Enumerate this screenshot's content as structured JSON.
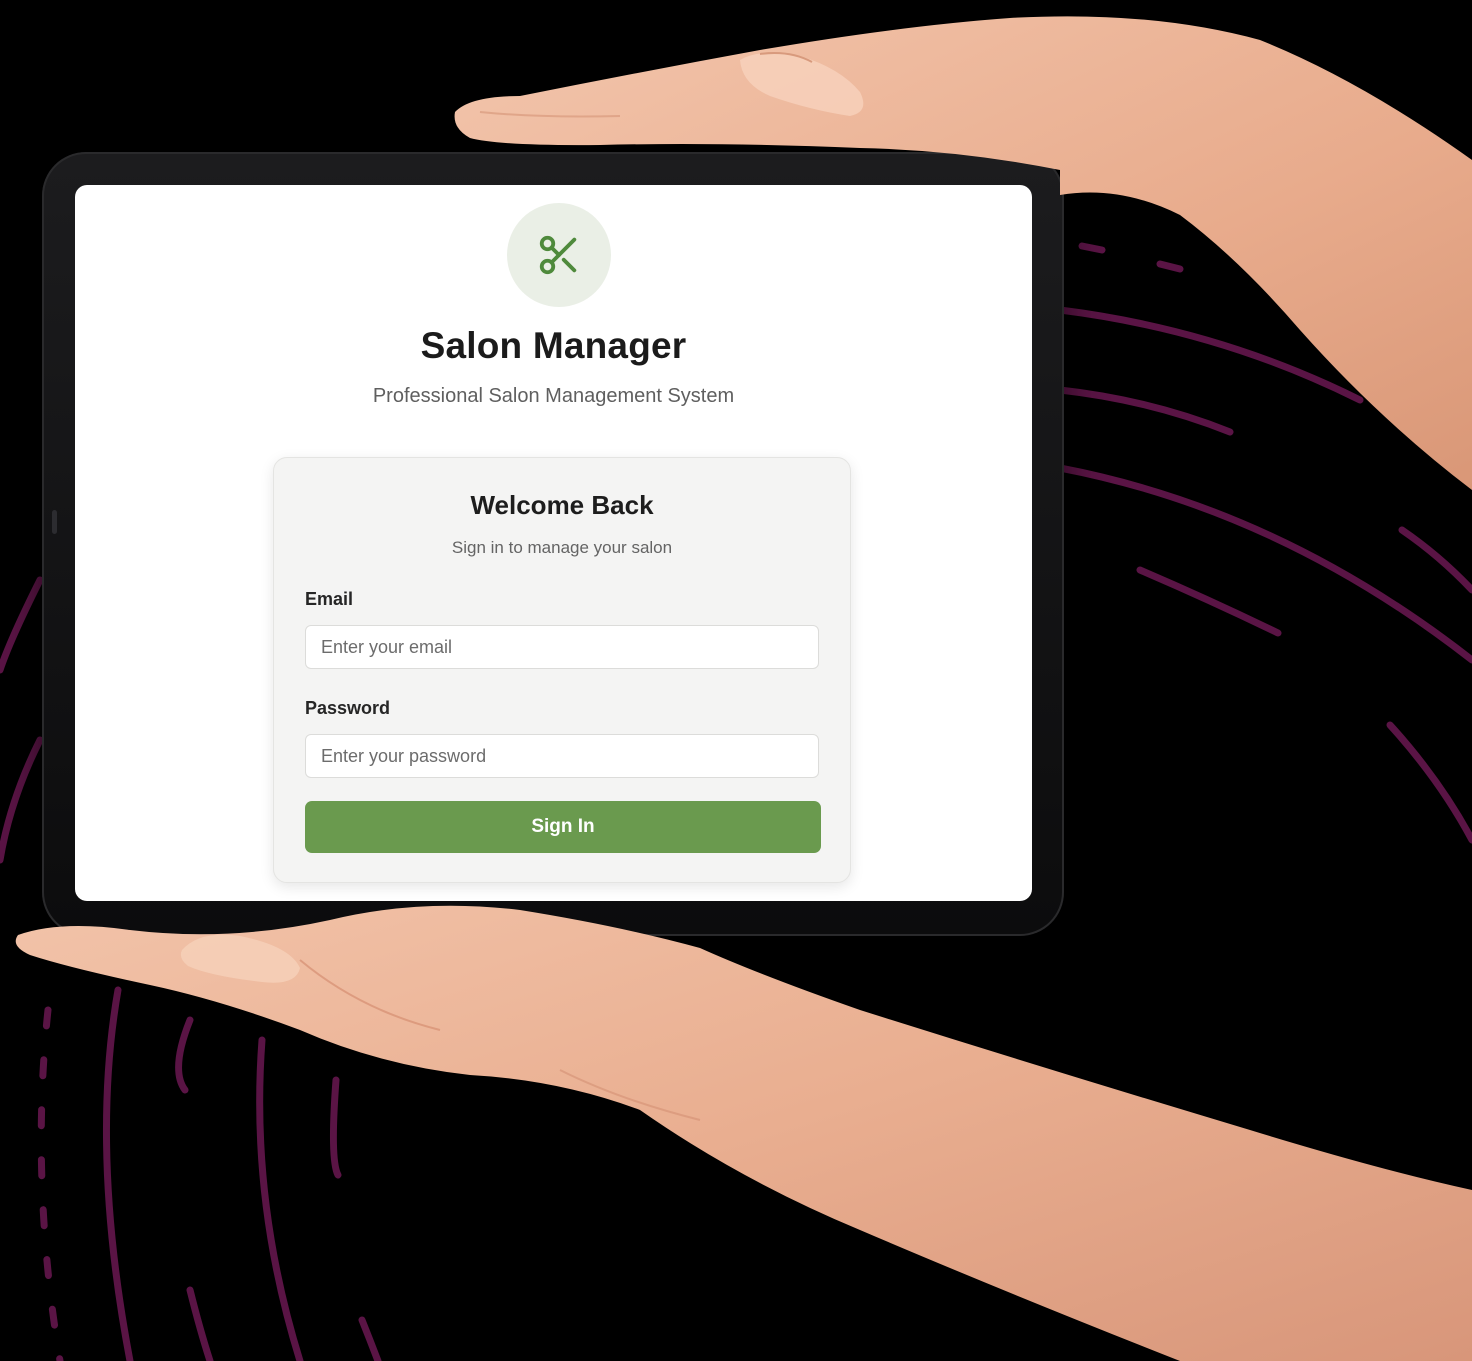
{
  "app": {
    "title": "Salon Manager",
    "subtitle": "Professional Salon Management System",
    "logo_icon": "scissors-icon"
  },
  "login_card": {
    "title": "Welcome Back",
    "subtitle": "Sign in to manage your salon",
    "email": {
      "label": "Email",
      "placeholder": "Enter your email",
      "value": ""
    },
    "password": {
      "label": "Password",
      "placeholder": "Enter your password",
      "value": ""
    },
    "submit_label": "Sign In"
  },
  "colors": {
    "accent": "#6a9a4e",
    "logo_bg": "#eaefe6",
    "background": "#000000",
    "decor_lines": "#5a1445"
  }
}
